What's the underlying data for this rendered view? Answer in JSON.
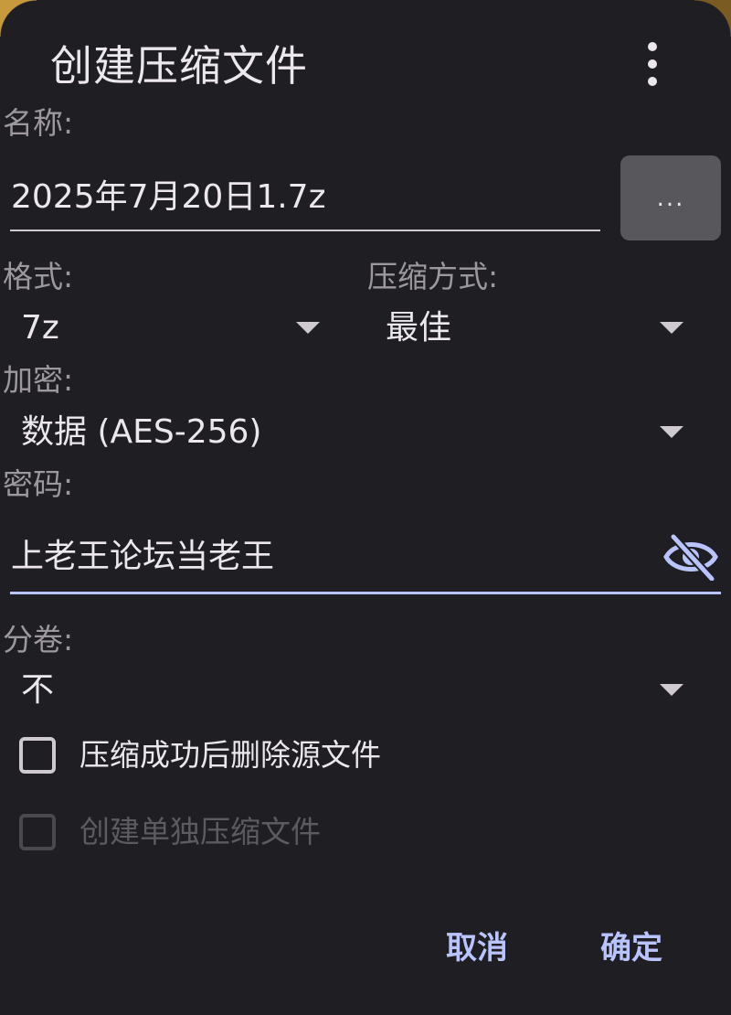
{
  "dialog": {
    "title": "创建压缩文件",
    "more_icon": "more-vert-icon"
  },
  "name": {
    "label": "名称:",
    "value": "2025年7月20日1.7z",
    "browse_label": "..."
  },
  "format": {
    "label": "格式:",
    "value": "7z"
  },
  "compression": {
    "label": "压缩方式:",
    "value": "最佳"
  },
  "encryption": {
    "label": "加密:",
    "value": "数据 (AES-256)"
  },
  "password": {
    "label": "密码:",
    "value": "上老王论坛当老王",
    "toggle_icon": "eye-off-icon"
  },
  "split": {
    "label": "分卷:",
    "value": "不"
  },
  "options": {
    "delete_source": {
      "label": "压缩成功后删除源文件",
      "checked": false,
      "enabled": true
    },
    "separate_archives": {
      "label": "创建单独压缩文件",
      "checked": false,
      "enabled": false
    }
  },
  "actions": {
    "cancel": "取消",
    "ok": "确定"
  },
  "colors": {
    "background": "#1f1e22",
    "accent": "#b9c3ff",
    "text": "#ece7ec",
    "label": "#9d989f"
  }
}
